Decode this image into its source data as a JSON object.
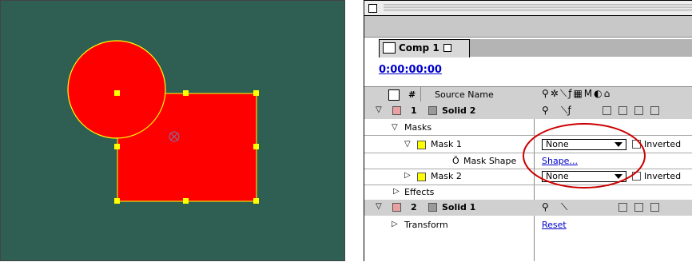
{
  "viewer": {
    "background": "#2f5f52",
    "circle_color": "#ff0000",
    "rect_color": "#ff0000",
    "mask_color": "#ffff00"
  },
  "timeline": {
    "tab_label": "Comp 1",
    "timecode": "0:00:00:00",
    "header": {
      "hash": "#",
      "source_name": "Source Name"
    },
    "layers": [
      {
        "number": "1",
        "name": "Solid 2",
        "label_color": "#e8a0a0"
      },
      {
        "number": "2",
        "name": "Solid 1",
        "label_color": "#e8a0a0"
      }
    ],
    "masks_label": "Masks",
    "mask1": {
      "name": "Mask 1",
      "mode": "None",
      "inverted": "Inverted",
      "color": "#ffff00"
    },
    "mask_shape": {
      "label": "Mask Shape",
      "value": "Shape..."
    },
    "mask2": {
      "name": "Mask 2",
      "mode": "None",
      "inverted": "Inverted",
      "color": "#ffff00"
    },
    "effects_label": "Effects",
    "transform": {
      "label": "Transform",
      "value": "Reset"
    },
    "highlight_color": "#cc0000"
  }
}
